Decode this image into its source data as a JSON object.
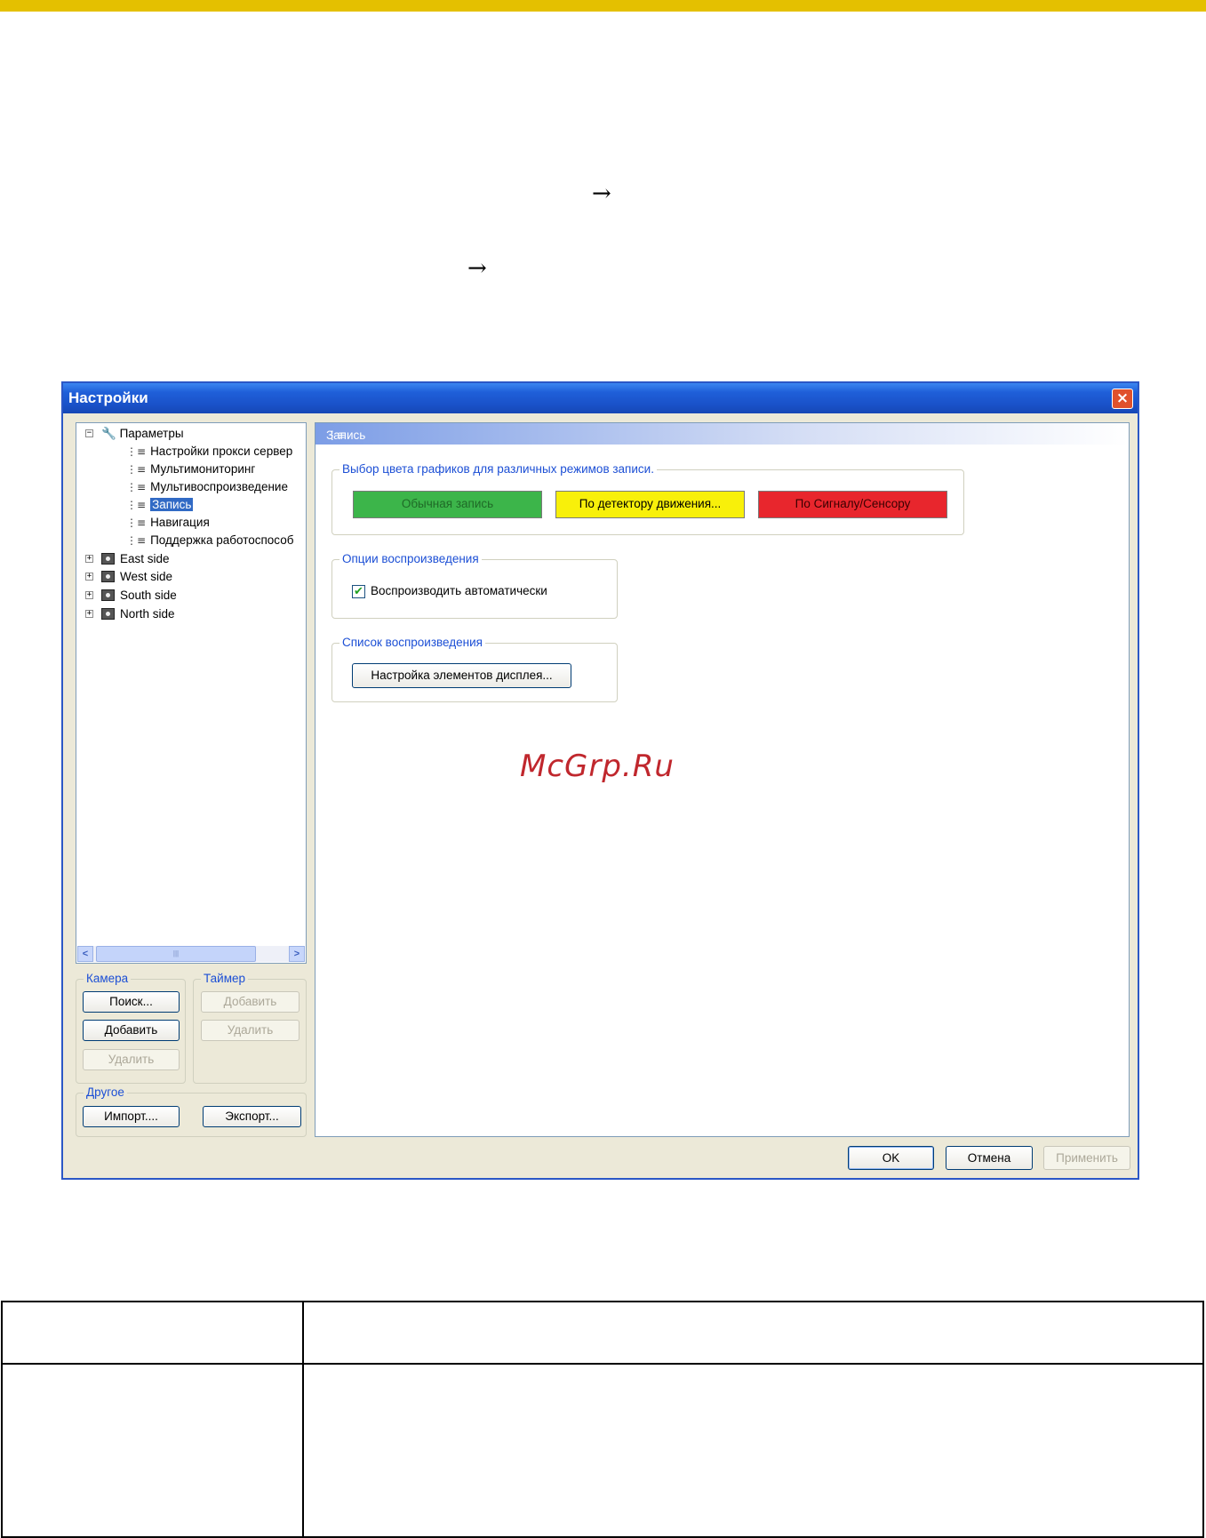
{
  "colors": {
    "accent_bar": "#e4c000",
    "title_bar": "#1f5fd9",
    "legend_text": "#1c4fd5",
    "btn_normal": "#3cb54a",
    "btn_motion": "#f8f00a",
    "btn_sensor": "#e8262d"
  },
  "page": {
    "arrow1": "→",
    "arrow2": "→",
    "watermark": "McGrp.Ru"
  },
  "dialog": {
    "title": "Настройки",
    "close_icon": "×",
    "tree": {
      "root": "Параметры",
      "children": [
        "Настройки прокси сервер",
        "Мультимониторинг",
        "Мультивоспроизведение",
        "Запись",
        "Навигация",
        "Поддержка работоспособ"
      ],
      "groups": [
        "East side",
        "West side",
        "South side",
        "North side"
      ]
    },
    "camera": {
      "legend": "Камера",
      "search": "Поиск...",
      "add": "Добавить",
      "remove": "Удалить"
    },
    "timer": {
      "legend": "Таймер",
      "add": "Добавить",
      "remove": "Удалить"
    },
    "other": {
      "legend": "Другое",
      "import": "Импорт....",
      "export": "Экспорт..."
    },
    "panel": {
      "header": "Запись",
      "colors_group": {
        "legend": "Выбор цвета графиков для различных режимов записи.",
        "normal": "Обычная запись",
        "motion": "По детектору движения...",
        "sensor": "По Сигналу/Сенсору"
      },
      "playback_options": {
        "legend": "Опции воспроизведения",
        "autoplay_label": "Воспроизводить автоматически",
        "autoplay_checked": true
      },
      "playlist": {
        "legend": "Список воспроизведения",
        "setup_button": "Настройка элементов дисплея..."
      }
    },
    "buttons": {
      "ok": "OK",
      "cancel": "Отмена",
      "apply": "Применить"
    }
  }
}
